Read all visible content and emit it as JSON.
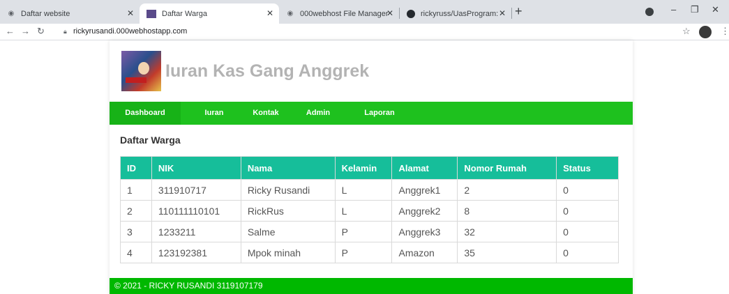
{
  "browser": {
    "tabs": [
      {
        "title": "Daftar website",
        "active": false
      },
      {
        "title": "Daftar Warga",
        "active": true
      },
      {
        "title": "000webhost File Manager",
        "active": false
      },
      {
        "title": "rickyruss/UasProgram: Iuran Kas",
        "active": false
      }
    ],
    "url": "rickyrusandi.000webhostapp.com"
  },
  "site": {
    "title": "Iuran Kas Gang Anggrek"
  },
  "nav": {
    "items": [
      "Dashboard",
      "Iuran",
      "Kontak",
      "Admin",
      "Laporan"
    ],
    "active": "Dashboard"
  },
  "main": {
    "section_title": "Daftar Warga",
    "table": {
      "headers": [
        "ID",
        "NIK",
        "Nama",
        "Kelamin",
        "Alamat",
        "Nomor Rumah",
        "Status"
      ],
      "rows": [
        [
          "1",
          "311910717",
          "Ricky Rusandi",
          "L",
          "Anggrek1",
          "2",
          "0"
        ],
        [
          "2",
          "110111110101",
          "RickRus",
          "L",
          "Anggrek2",
          "8",
          "0"
        ],
        [
          "3",
          "1233211",
          "Salme",
          "P",
          "Anggrek3",
          "32",
          "0"
        ],
        [
          "4",
          "123192381",
          "Mpok minah",
          "P",
          "Amazon",
          "35",
          "0"
        ]
      ]
    }
  },
  "footer": {
    "text": "© 2021 - RICKY RUSANDI 3119107179"
  },
  "colors": {
    "nav_green": "#1ec11e",
    "table_header": "#16be9a",
    "footer_green": "#00b800",
    "title_gray": "#b3b3b3"
  }
}
